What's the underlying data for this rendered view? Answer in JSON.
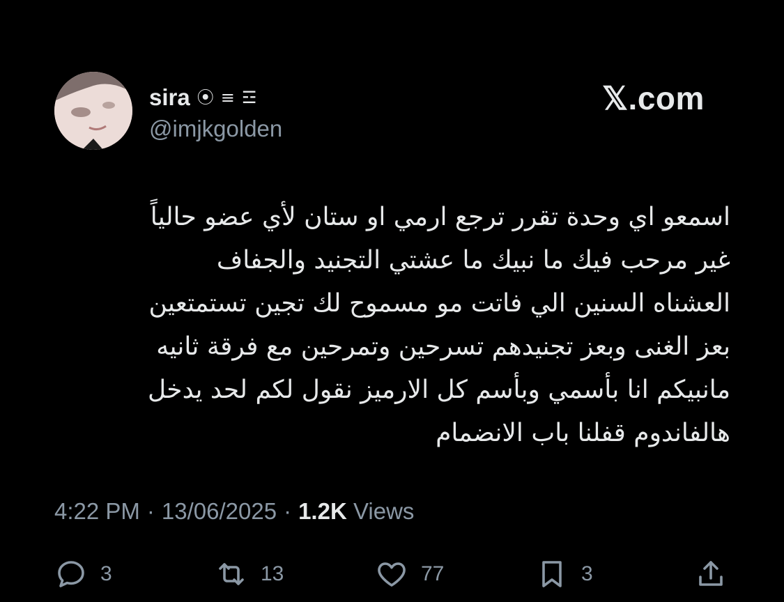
{
  "author": {
    "name": "sira",
    "handle": "@imjkgolden",
    "badges": [
      "⦿",
      "≡",
      "☲"
    ],
    "avatar_icon": "avatar-photo"
  },
  "site": {
    "label": "𝕏.com"
  },
  "tweet": {
    "lines": [
      "اسمعو اي وحدة تقرر ترجع ارمي او ستان لأي عضو حالياً",
      "غير مرحب فيك ما نبيك ما عشتي التجنيد والجفاف",
      "العشناه السنين الي فاتت مو مسموح لك تجين تستمتعين",
      "بعز الغنى وبعز تجنيدهم تسرحين وتمرحين مع فرقة ثانيه",
      "مانبيكم انا بأسمي وبأسم كل الارميز نقول لكم لحد يدخل",
      "هالفاندوم قفلنا باب الانضمام"
    ]
  },
  "meta": {
    "time": "4:22 PM",
    "sep1": "·",
    "date": "13/06/2025",
    "sep2": "·",
    "views_count": "1.2K",
    "views_label": "Views"
  },
  "actions": {
    "replies": "3",
    "reposts": "13",
    "likes": "77",
    "bookmarks": "3"
  },
  "colors": {
    "background": "#000000",
    "text": "#e7e9ea",
    "muted": "#8b98a5"
  }
}
